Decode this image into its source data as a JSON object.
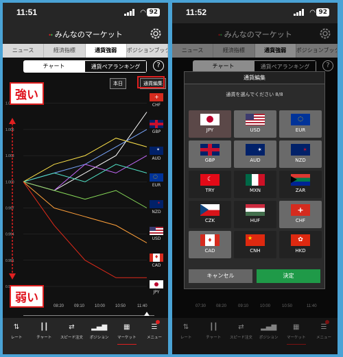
{
  "left": {
    "status": {
      "time": "11:51",
      "battery": "92"
    },
    "app_title": "みんなのマーケット",
    "tabs": [
      "ニュース",
      "経済指標",
      "通貨強弱",
      "ポジションブック"
    ],
    "active_tab": "通貨強弱",
    "segment": {
      "chart": "チャート",
      "ranking": "通貨ペアランキング"
    },
    "buttons": {
      "today": "本日",
      "edit": "通貨編集",
      "help": "?"
    },
    "callouts": {
      "strong": "強い",
      "weak": "弱い"
    },
    "y_labels": [
      "1.009",
      "1.006",
      "1.003",
      "1.000",
      "0.997",
      "0.994",
      "0.991",
      "0.988"
    ],
    "x_labels": [
      "08:20",
      "09:10",
      "10:00",
      "10:50",
      "11:40"
    ],
    "currencies": [
      "CHF",
      "GBP",
      "AUD",
      "EUR",
      "NZD",
      "USD",
      "CAD",
      "JPY"
    ],
    "chart_data": {
      "type": "line",
      "x": [
        "08:20",
        "09:10",
        "10:00",
        "10:50",
        "11:40"
      ],
      "ylim": [
        0.988,
        1.01
      ],
      "series": [
        {
          "name": "CHF",
          "color": "#ffffff",
          "values": [
            1.0,
            0.999,
            1.001,
            1.003,
            1.008
          ]
        },
        {
          "name": "GBP",
          "color": "#7aa7ff",
          "values": [
            1.0,
            1.001,
            1.002,
            1.004,
            1.006
          ]
        },
        {
          "name": "AUD",
          "color": "#ffe44a",
          "values": [
            1.0,
            1.002,
            1.003,
            1.005,
            1.004
          ]
        },
        {
          "name": "EUR",
          "color": "#c86bff",
          "values": [
            1.0,
            0.999,
            1.002,
            1.001,
            1.003
          ]
        },
        {
          "name": "NZD",
          "color": "#52e5c9",
          "values": [
            1.0,
            1.001,
            1.0,
            1.002,
            1.001
          ]
        },
        {
          "name": "USD",
          "color": "#8ade5a",
          "values": [
            1.0,
            0.999,
            0.998,
            0.999,
            0.997
          ]
        },
        {
          "name": "CAD",
          "color": "#ffa03a",
          "values": [
            1.0,
            0.997,
            0.996,
            0.995,
            0.993
          ]
        },
        {
          "name": "JPY",
          "color": "#e02a1a",
          "values": [
            1.0,
            0.995,
            0.991,
            0.989,
            0.989
          ]
        }
      ]
    },
    "nav": [
      "レート",
      "チャート",
      "スピード注文",
      "ポジション",
      "マーケット",
      "メニュー"
    ]
  },
  "right": {
    "status": {
      "time": "11:52",
      "battery": "92"
    },
    "app_title": "みんなのマーケット",
    "tabs": [
      "ニュース",
      "経済指標",
      "通貨強弱",
      "ポジションブック"
    ],
    "segment": {
      "chart": "チャート",
      "ranking": "通貨ペアランキング"
    },
    "modal": {
      "title": "通貨編集",
      "subtitle": "通貨を選んでください 8/8",
      "currencies": [
        "JPY",
        "USD",
        "EUR",
        "GBP",
        "AUD",
        "NZD",
        "TRY",
        "MXN",
        "ZAR",
        "CZK",
        "HUF",
        "CHF",
        "CAD",
        "CNH",
        "HKD"
      ],
      "cancel": "キャンセル",
      "ok": "決定"
    },
    "x_labels": [
      "07:30",
      "08:20",
      "09:10",
      "10:00",
      "10:50",
      "11:40"
    ],
    "nav": [
      "レート",
      "チャート",
      "スピード注文",
      "ポジション",
      "マーケット",
      "メニュー"
    ]
  },
  "colors": {
    "accent_red": "#e02020",
    "ok_green": "#1f9a48"
  }
}
